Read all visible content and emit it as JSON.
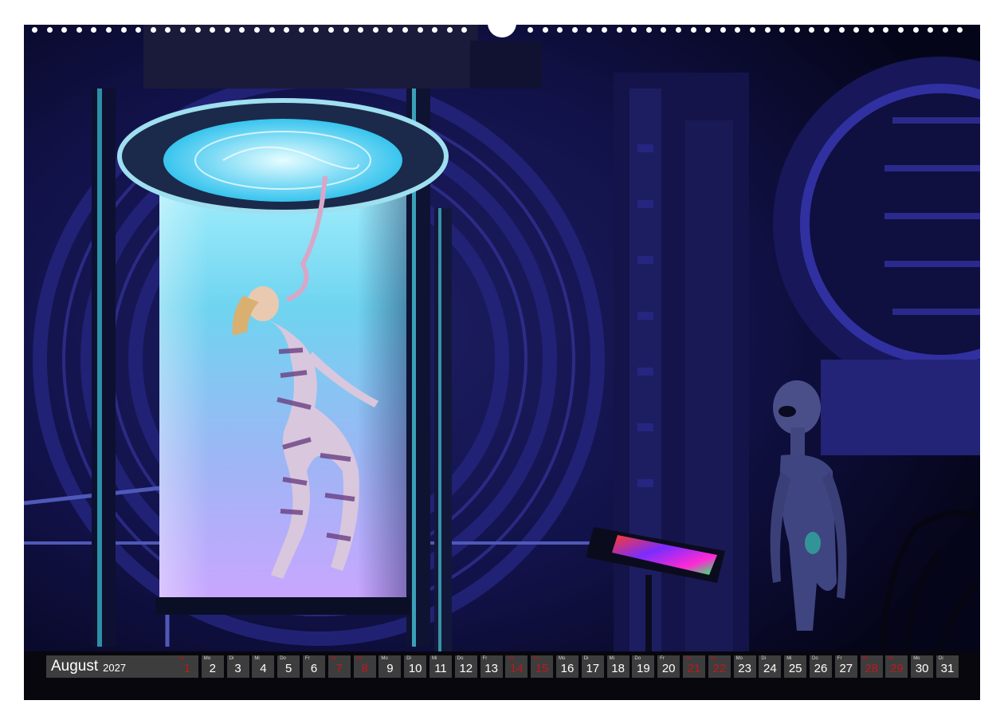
{
  "calendar": {
    "month": "August",
    "year": "2027",
    "weekend_color": "#c0161d",
    "days": [
      {
        "wd": "So",
        "num": "1",
        "weekend": true
      },
      {
        "wd": "Mo",
        "num": "2",
        "weekend": false
      },
      {
        "wd": "Di",
        "num": "3",
        "weekend": false
      },
      {
        "wd": "Mi",
        "num": "4",
        "weekend": false
      },
      {
        "wd": "Do",
        "num": "5",
        "weekend": false
      },
      {
        "wd": "Fr",
        "num": "6",
        "weekend": false
      },
      {
        "wd": "Sa",
        "num": "7",
        "weekend": true
      },
      {
        "wd": "So",
        "num": "8",
        "weekend": true
      },
      {
        "wd": "Mo",
        "num": "9",
        "weekend": false
      },
      {
        "wd": "Di",
        "num": "10",
        "weekend": false
      },
      {
        "wd": "Mi",
        "num": "11",
        "weekend": false
      },
      {
        "wd": "Do",
        "num": "12",
        "weekend": false
      },
      {
        "wd": "Fr",
        "num": "13",
        "weekend": false
      },
      {
        "wd": "Sa",
        "num": "14",
        "weekend": true
      },
      {
        "wd": "So",
        "num": "15",
        "weekend": true
      },
      {
        "wd": "Mo",
        "num": "16",
        "weekend": false
      },
      {
        "wd": "Di",
        "num": "17",
        "weekend": false
      },
      {
        "wd": "Mi",
        "num": "18",
        "weekend": false
      },
      {
        "wd": "Do",
        "num": "19",
        "weekend": false
      },
      {
        "wd": "Fr",
        "num": "20",
        "weekend": false
      },
      {
        "wd": "Sa",
        "num": "21",
        "weekend": true
      },
      {
        "wd": "So",
        "num": "22",
        "weekend": true
      },
      {
        "wd": "Mo",
        "num": "23",
        "weekend": false
      },
      {
        "wd": "Di",
        "num": "24",
        "weekend": false
      },
      {
        "wd": "Mi",
        "num": "25",
        "weekend": false
      },
      {
        "wd": "Do",
        "num": "26",
        "weekend": false
      },
      {
        "wd": "Fr",
        "num": "27",
        "weekend": false
      },
      {
        "wd": "Sa",
        "num": "28",
        "weekend": true
      },
      {
        "wd": "So",
        "num": "29",
        "weekend": true
      },
      {
        "wd": "Mo",
        "num": "30",
        "weekend": false
      },
      {
        "wd": "Di",
        "num": "31",
        "weekend": false
      }
    ]
  },
  "artwork": {
    "subject": "sci-fi-lab-scene",
    "palette": {
      "background": "#0b0a2a",
      "tube_glow": "#9fe8ff",
      "tube_lower": "#c9a6ff",
      "alien": "#4a4f8a"
    }
  }
}
